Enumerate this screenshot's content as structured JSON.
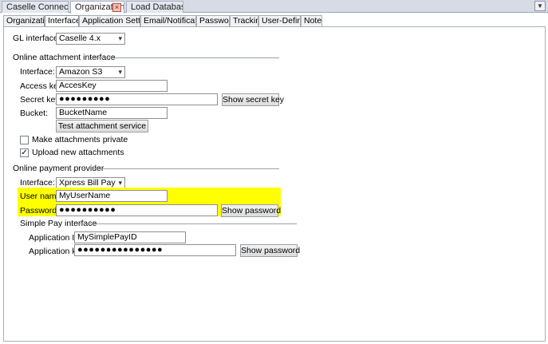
{
  "doc_tabs": [
    {
      "label": "Caselle Connect®"
    },
    {
      "label": "Organization"
    },
    {
      "label": "Load Databases"
    }
  ],
  "sub_tabs": [
    "Organization",
    "Interfaces",
    "Application Settings",
    "Email/Notifications",
    "Passwords",
    "Tracking",
    "User-Defined",
    "Notes"
  ],
  "gl": {
    "label": "GL interface:",
    "value": "Caselle 4.x"
  },
  "attachment": {
    "section_title": "Online attachment interface",
    "interface_label": "Interface:",
    "interface_value": "Amazon S3",
    "access_key_label": "Access key:",
    "access_key_value": "AccesKey",
    "secret_key_label": "Secret key:",
    "secret_key_value": "●●●●●●●●●",
    "show_secret_key": "Show secret key",
    "bucket_label": "Bucket:",
    "bucket_value": "BucketName",
    "test_button": "Test attachment service",
    "private_label": "Make attachments private",
    "private_checked": false,
    "upload_label": "Upload new attachments",
    "upload_checked": true
  },
  "payment": {
    "section_title": "Online payment provider",
    "interface_label": "Interface:",
    "interface_value": "Xpress Bill Pay",
    "user_label": "User name:",
    "user_value": "MyUserName",
    "password_label": "Password:",
    "password_value": "●●●●●●●●●●",
    "show_password": "Show password",
    "highlight_color": "#ffff00"
  },
  "simple_pay": {
    "section_title": "Simple Pay interface",
    "app_id_label": "Application ID:",
    "app_id_value": "MySimplePayID",
    "app_key_label": "Application key:",
    "app_key_value": "●●●●●●●●●●●●●●●",
    "show_password": "Show password"
  }
}
